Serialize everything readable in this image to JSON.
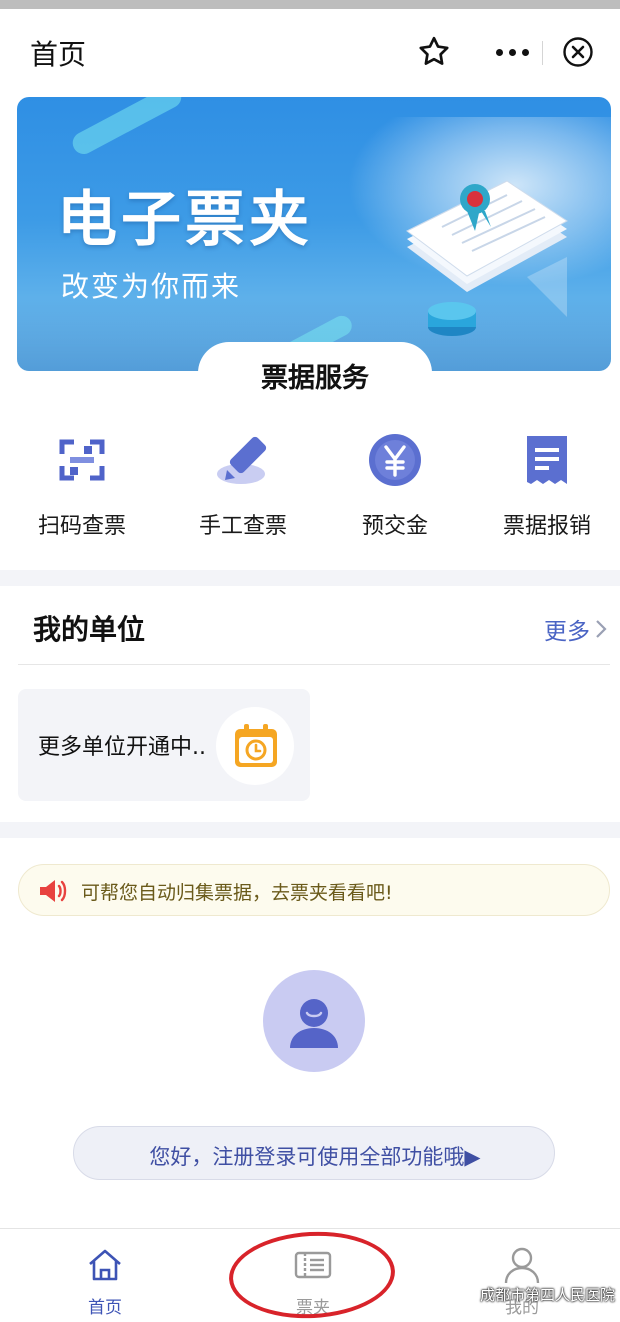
{
  "navbar": {
    "title": "首页",
    "star_icon": "star-icon",
    "more_icon": "more-dots-icon",
    "close_icon": "close-circle-icon"
  },
  "banner": {
    "title": "电子票夹",
    "subtitle": "改变为你而来",
    "art_icon": "document-certificate-illustration"
  },
  "services": {
    "title": "票据服务",
    "items": [
      {
        "label": "扫码查票",
        "icon": "scan-qr-icon"
      },
      {
        "label": "手工查票",
        "icon": "pen-edit-icon"
      },
      {
        "label": "预交金",
        "icon": "yen-coin-icon"
      },
      {
        "label": "票据报销",
        "icon": "receipt-icon"
      }
    ]
  },
  "units": {
    "title": "我的单位",
    "more_label": "更多",
    "card_text": "更多单位开通中..",
    "card_icon": "calendar-clock-icon"
  },
  "notice": {
    "text": "可帮您自动归集票据，去票夹看看吧!",
    "icon": "speaker-icon"
  },
  "login": {
    "text": "您好，注册登录可使用全部功能哦▶",
    "avatar_icon": "user-avatar-icon"
  },
  "tabbar": {
    "items": [
      {
        "label": "首页",
        "icon": "home-icon",
        "active": true
      },
      {
        "label": "票夹",
        "icon": "ticket-wallet-icon",
        "active": false
      },
      {
        "label": "我的",
        "icon": "person-icon",
        "active": false
      }
    ]
  },
  "watermark": {
    "text": "成都市第四人民医院"
  },
  "colors": {
    "accent": "#3d53b5",
    "banner_blue": "#2f8fe4",
    "annotation_red": "#d8232a",
    "icon_blue": "#5b6fd0"
  }
}
